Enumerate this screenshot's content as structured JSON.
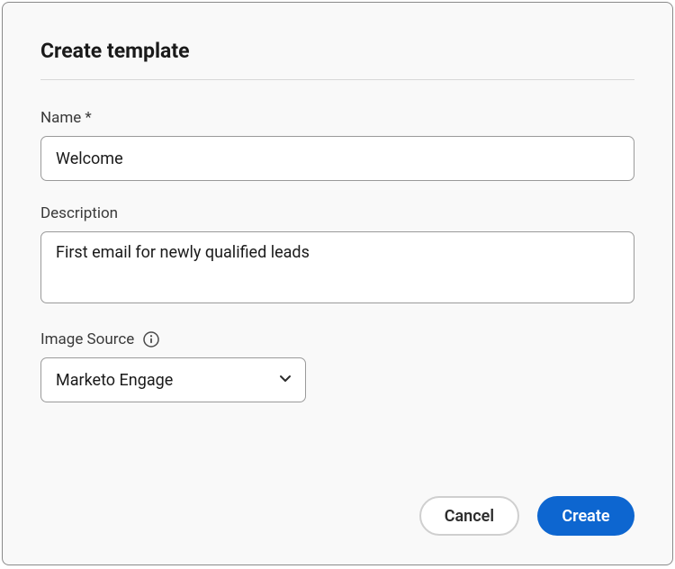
{
  "dialog": {
    "title": "Create template"
  },
  "fields": {
    "name": {
      "label": "Name",
      "required_mark": "*",
      "value": "Welcome"
    },
    "description": {
      "label": "Description",
      "value": "First email for newly qualified leads"
    },
    "imageSource": {
      "label": "Image Source",
      "selected": "Marketo Engage"
    }
  },
  "buttons": {
    "cancel": "Cancel",
    "create": "Create"
  },
  "colors": {
    "primary": "#0d66d0",
    "border": "#9a9a9a",
    "divider": "#d8d8d8",
    "dialogBorder": "#8a8a8a",
    "background": "#f9f9f9"
  }
}
